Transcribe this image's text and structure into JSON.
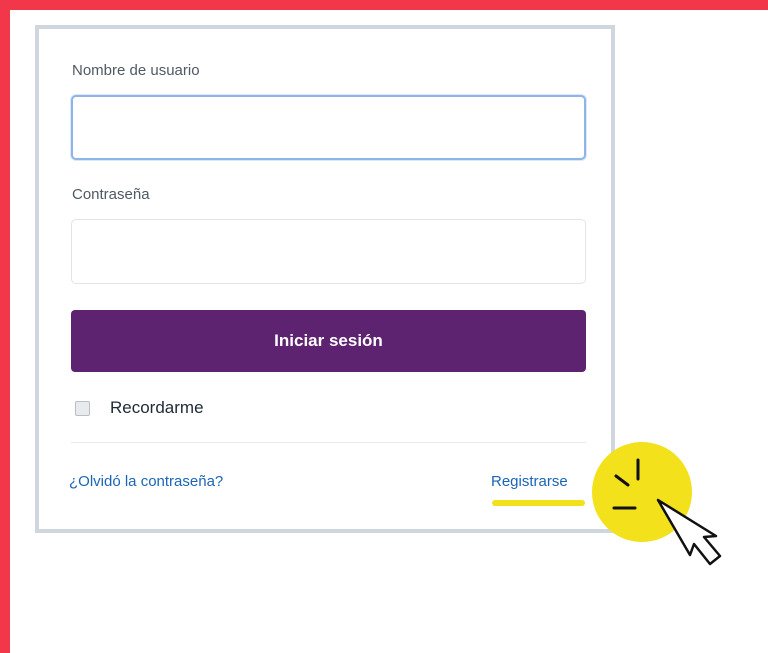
{
  "login_form": {
    "username_label": "Nombre de usuario",
    "username_value": "",
    "password_label": "Contraseña",
    "password_value": "",
    "login_button_label": "Iniciar sesión",
    "remember_me_label": "Recordarme",
    "remember_me_checked": false,
    "forgot_password_link": "¿Olvidó la contraseña?",
    "register_link": "Registrarse"
  },
  "colors": {
    "frame_accent": "#f2374b",
    "button_background": "#5d2371",
    "link": "#1b65b6",
    "highlight": "#f2e11b",
    "focus_border": "#8fb4e8"
  },
  "icons": {
    "cursor": "pointer-cursor-icon",
    "click_burst": "click-burst-icon"
  }
}
